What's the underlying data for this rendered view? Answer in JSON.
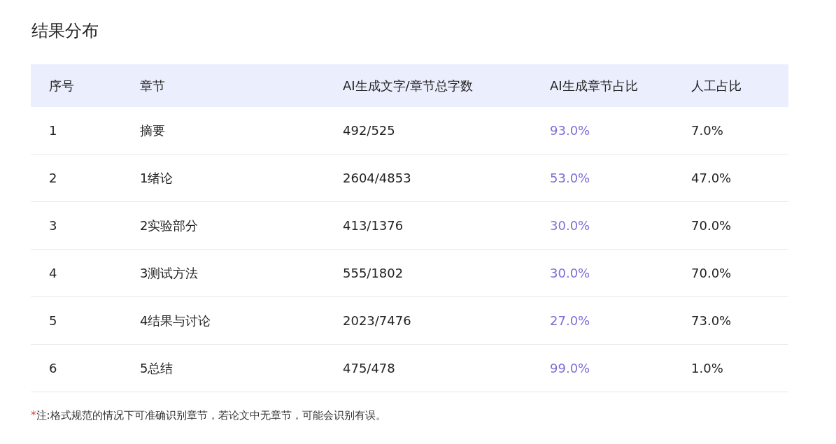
{
  "title": "结果分布",
  "table": {
    "columns": [
      {
        "label": "序号",
        "kind": "plain"
      },
      {
        "label": "章节",
        "kind": "plain"
      },
      {
        "label": "AI生成文字/章节总字数",
        "kind": "plain"
      },
      {
        "label": "AI生成章节占比",
        "kind": "accent"
      },
      {
        "label": "人工占比",
        "kind": "plain"
      }
    ],
    "rows": [
      [
        "1",
        "摘要",
        "492/525",
        "93.0%",
        "7.0%"
      ],
      [
        "2",
        "1绪论",
        "2604/4853",
        "53.0%",
        "47.0%"
      ],
      [
        "3",
        "2实验部分",
        "413/1376",
        "30.0%",
        "70.0%"
      ],
      [
        "4",
        "3测试方法",
        "555/1802",
        "30.0%",
        "70.0%"
      ],
      [
        "5",
        "4结果与讨论",
        "2023/7476",
        "27.0%",
        "73.0%"
      ],
      [
        "6",
        "5总结",
        "475/478",
        "99.0%",
        "1.0%"
      ]
    ]
  },
  "note": {
    "mark": "*",
    "text": "注:格式规范的情况下可准确识别章节，若论文中无章节，可能会识别有误。"
  }
}
